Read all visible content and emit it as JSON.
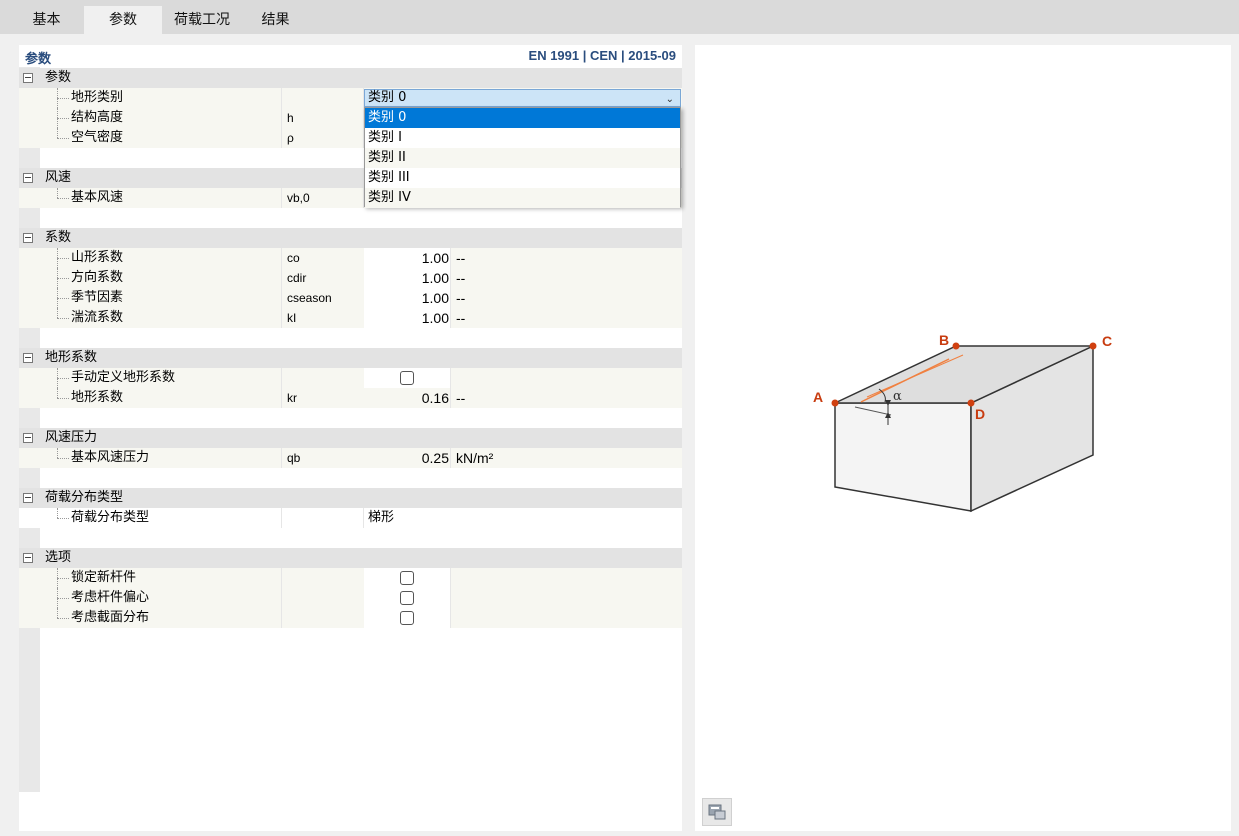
{
  "tabs": [
    {
      "label": "基本"
    },
    {
      "label": "参数"
    },
    {
      "label": "荷载工况"
    },
    {
      "label": "结果"
    }
  ],
  "header": {
    "title": "参数",
    "standard": "EN 1991 | CEN | 2015-09"
  },
  "groups": {
    "params": {
      "title": "参数",
      "terrain_category": {
        "label": "地形类别",
        "value": "类别 0"
      },
      "structure_height": {
        "label": "结构高度",
        "symbol": "h"
      },
      "air_density": {
        "label": "空气密度",
        "symbol": "ρ"
      }
    },
    "wind_speed": {
      "title": "风速",
      "basic_wind_speed": {
        "label": "基本风速",
        "symbol": "vb,0"
      }
    },
    "coefficients": {
      "title": "系数",
      "orography": {
        "label": "山形系数",
        "symbol": "co",
        "value": "1.00",
        "unit": "--"
      },
      "direction": {
        "label": "方向系数",
        "symbol": "cdir",
        "value": "1.00",
        "unit": "--"
      },
      "season": {
        "label": "季节因素",
        "symbol": "cseason",
        "value": "1.00",
        "unit": "--"
      },
      "turbulence": {
        "label": "湍流系数",
        "symbol": "kI",
        "value": "1.00",
        "unit": "--"
      }
    },
    "terrain_factor": {
      "title": "地形系数",
      "manual_define": {
        "label": "手动定义地形系数"
      },
      "factor": {
        "label": "地形系数",
        "symbol": "kr",
        "value": "0.16",
        "unit": "--"
      }
    },
    "velocity_pressure": {
      "title": "风速压力",
      "basic_pressure": {
        "label": "基本风速压力",
        "symbol": "qb",
        "value": "0.25",
        "unit": "kN/m²"
      }
    },
    "load_distribution": {
      "title": "荷载分布类型",
      "type": {
        "label": "荷载分布类型",
        "value": "梯形"
      }
    },
    "options": {
      "title": "选项",
      "lock_new_members": {
        "label": "锁定新杆件"
      },
      "member_eccentricity": {
        "label": "考虑杆件偏心"
      },
      "section_distribution": {
        "label": "考虑截面分布"
      }
    }
  },
  "dropdown_options": [
    "类别 0",
    "类别 I",
    "类别 II",
    "类别 III",
    "类别 IV"
  ],
  "diagram": {
    "labels": {
      "A": "A",
      "B": "B",
      "C": "C",
      "D": "D",
      "alpha": "α"
    },
    "colors": {
      "point": "#d04010",
      "label": "#c83c10",
      "ridge": "#f08040"
    }
  }
}
